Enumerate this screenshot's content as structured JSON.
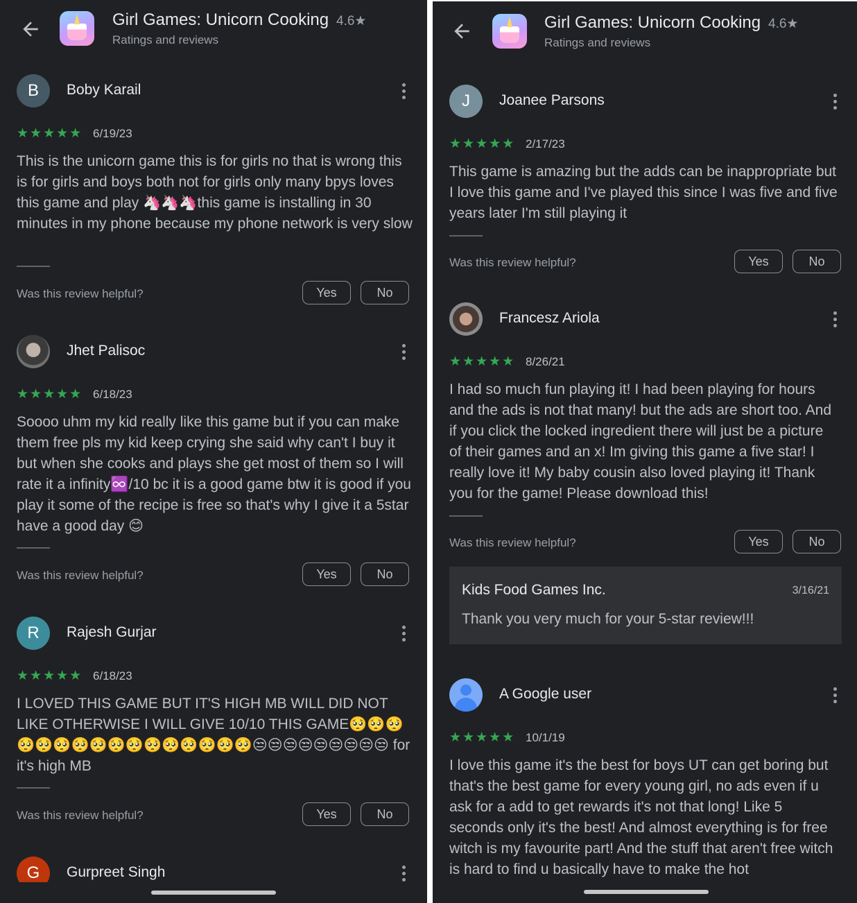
{
  "app": {
    "title": "Girl Games: Unicorn Cooking",
    "rating": "4.6★",
    "subtitle": "Ratings and reviews"
  },
  "left": {
    "reviews": [
      {
        "initial": "B",
        "avatar_color": "#455a64",
        "name": "Boby Karail",
        "stars": "★★★★★",
        "date": "6/19/23",
        "text": "This is the unicorn game this is for girls no that is wrong this is for girls and boys both not for girls only many bpys loves this game and play 🦄🦄🦄this game is installing in 30 minutes in my phone because my phone network is very slow"
      },
      {
        "initial": "",
        "avatar_color": "photo",
        "name": "Jhet Palisoc",
        "stars": "★★★★★",
        "date": "6/18/23",
        "text": "Soooo uhm my kid really like this game but if you can make them free pls my kid keep crying she said why can't I buy it but when she cooks and plays she get most of them so I will rate it a infinity♾️/10 bc it is a good game btw it is good if you play it some of the recipe is free so that's why I give it a 5star have a good day 😊"
      },
      {
        "initial": "R",
        "avatar_color": "#3d8c9c",
        "name": "Rajesh Gurjar",
        "stars": "★★★★★",
        "date": "6/18/23",
        "text": "I LOVED THIS GAME BUT IT'S HIGH MB WILL DID NOT LIKE OTHERWISE I WILL GIVE 10/10 THIS GAME🥺🥺🥺🥺🥺🥺🥺🥺🥺🥺🥺🥺🥺🥺🥺🥺😒😒😒😒😒😒😒😒😒 for it's high MB"
      },
      {
        "initial": "G",
        "avatar_color": "#bf360c",
        "name": "Gurpreet Singh"
      }
    ]
  },
  "right": {
    "reviews": [
      {
        "initial": "J",
        "avatar_color": "#78909c",
        "name": "Joanee Parsons",
        "stars": "★★★★★",
        "date": "2/17/23",
        "text": "This game is amazing but the adds can be inappropriate but I love this game and I've played this since I was five and five years later I'm still playing it"
      },
      {
        "initial": "",
        "avatar_color": "photo",
        "name": "Francesz Ariola",
        "stars": "★★★★★",
        "date": "8/26/21",
        "text": "I had so much fun playing it! I had been playing for hours and the ads is not that many! but the ads are short too. And if you click the locked ingredient there will just be a picture of their games and an x! Im giving this game a five star! I really love it! My baby cousin also loved playing it! Thank you for the game! Please download this!"
      },
      {
        "initial": "",
        "avatar_color": "google-user",
        "name": "A Google user",
        "stars": "★★★★★",
        "date": "10/1/19",
        "text": "I love this game it's the best for boys UT can get boring but that's the best game for every young girl, no ads even if u ask for a add to get rewards it's not that long! Like 5 seconds only it's the best! And almost everything is for free witch is my favourite part! And the stuff that aren't free witch is hard to find u basically have to make the hot"
      }
    ],
    "developer_reply": {
      "developer": "Kids Food Games Inc.",
      "date": "3/16/21",
      "text": "Thank you very much for your 5-star review!!!"
    }
  },
  "ui": {
    "helpful_question": "Was this review helpful?",
    "yes_label": "Yes",
    "no_label": "No",
    "icons": [
      "arrow-back-icon",
      "more-vert-icon",
      "star-icon"
    ]
  }
}
